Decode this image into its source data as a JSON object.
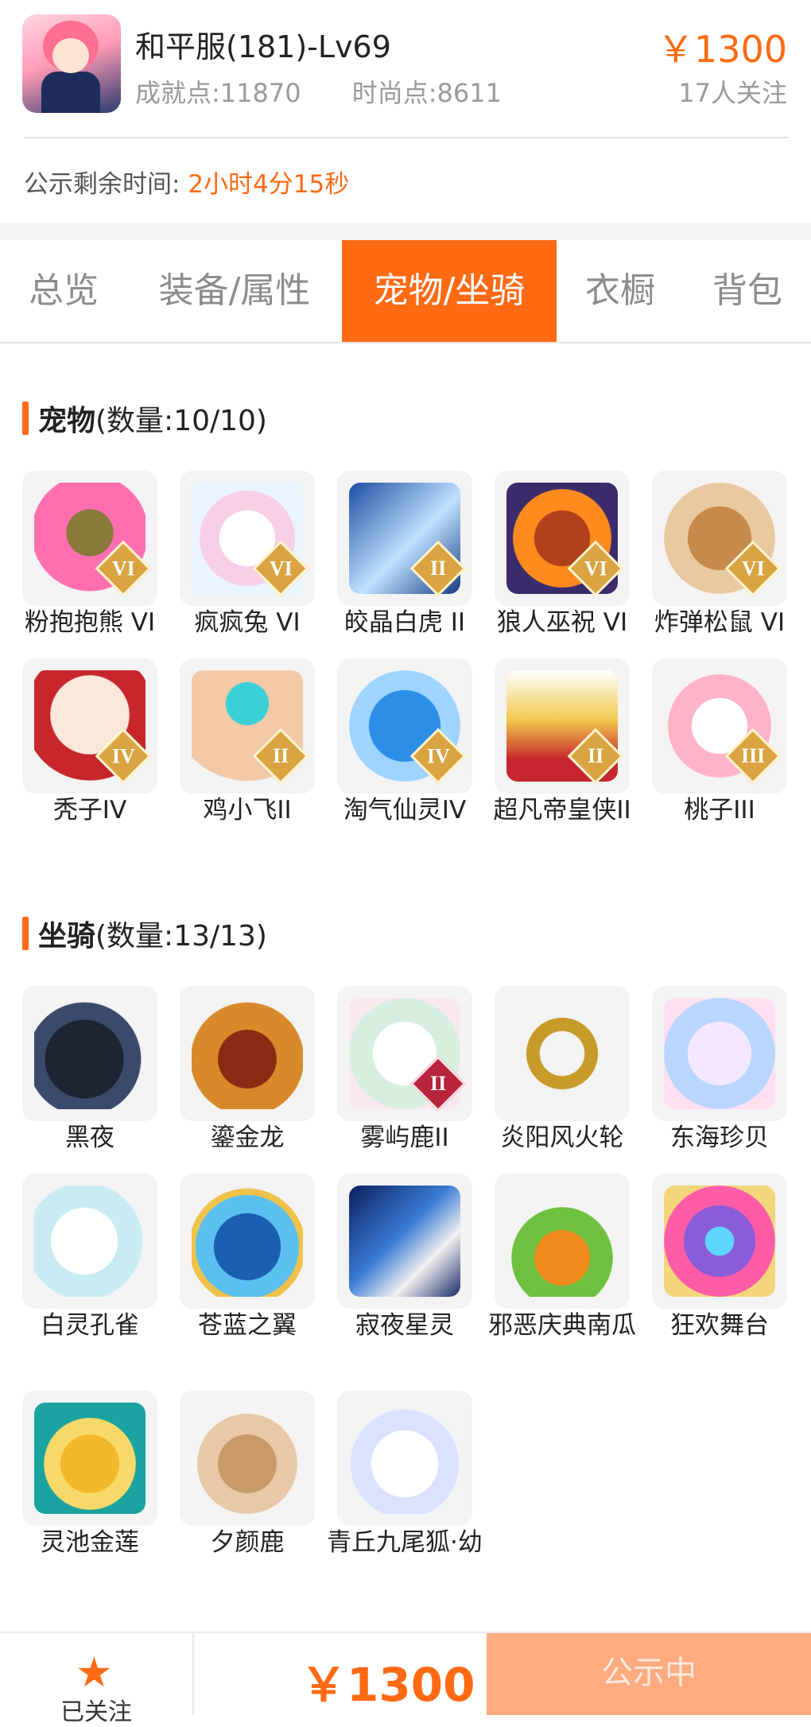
{
  "header": {
    "title": "和平服(181)-Lv69",
    "achievement": "成就点:11870",
    "fashion": "时尚点:8611",
    "price": "￥1300",
    "followers": "17人关注",
    "countdown_label": "公示剩余时间:",
    "countdown_value": "2小时4分15秒"
  },
  "tabs": [
    "总览",
    "装备/属性",
    "宠物/坐骑",
    "衣橱",
    "背包"
  ],
  "active_tab": "宠物/坐骑",
  "pets": {
    "title": "宠物",
    "count": "(数量:10/10)",
    "items": [
      {
        "name": "粉抱抱熊 VI",
        "badge": "VI"
      },
      {
        "name": "疯疯兔 VI",
        "badge": "VI"
      },
      {
        "name": "皎晶白虎 II",
        "badge": "II"
      },
      {
        "name": "狼人巫祝 VI",
        "badge": "VI"
      },
      {
        "name": "炸弹松鼠 VI",
        "badge": "VI"
      },
      {
        "name": "秃子IV",
        "badge": "IV"
      },
      {
        "name": "鸡小飞II",
        "badge": "II"
      },
      {
        "name": "淘气仙灵IV",
        "badge": "IV"
      },
      {
        "name": "超凡帝皇侠II",
        "badge": "II"
      },
      {
        "name": "桃子III",
        "badge": "III"
      }
    ]
  },
  "mounts": {
    "title": "坐骑",
    "count": "(数量:13/13)",
    "items": [
      {
        "name": "黑夜",
        "badge": ""
      },
      {
        "name": "鎏金龙",
        "badge": ""
      },
      {
        "name": "雾屿鹿II",
        "badge": "II"
      },
      {
        "name": "炎阳风火轮",
        "badge": ""
      },
      {
        "name": "东海珍贝",
        "badge": ""
      },
      {
        "name": "白灵孔雀",
        "badge": ""
      },
      {
        "name": "苍蓝之翼",
        "badge": ""
      },
      {
        "name": "寂夜星灵",
        "badge": ""
      },
      {
        "name": "邪恶庆典南瓜",
        "badge": ""
      },
      {
        "name": "狂欢舞台",
        "badge": ""
      },
      {
        "name": "灵池金莲",
        "badge": ""
      },
      {
        "name": "夕颜鹿",
        "badge": ""
      },
      {
        "name": "青丘九尾狐·幼",
        "badge": ""
      }
    ]
  },
  "bottom": {
    "follow_label": "已关注",
    "price": "￥1300",
    "status": "公示中"
  },
  "colors": {
    "accent": "#ff6a13",
    "status_button": "#ffab80"
  }
}
